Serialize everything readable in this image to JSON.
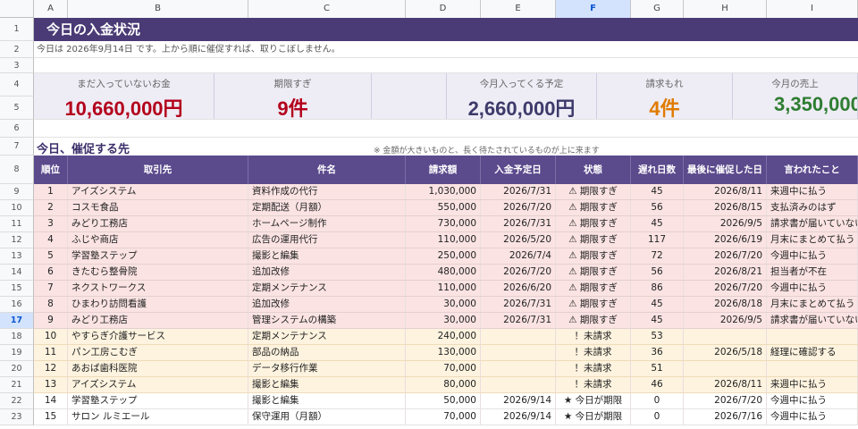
{
  "columns": [
    "A",
    "B",
    "C",
    "D",
    "E",
    "F",
    "G",
    "H",
    "I"
  ],
  "selected_column": "F",
  "rows_header": [
    "1",
    "2",
    "3",
    "4",
    "5",
    "6",
    "7",
    "8",
    "9",
    "10",
    "11",
    "12",
    "13",
    "14",
    "15",
    "16",
    "17",
    "18",
    "19",
    "20",
    "21",
    "22",
    "23"
  ],
  "selected_row": "17",
  "title": "今日の入金状況",
  "subtitle": "今日は 2026年9月14日 です。上から順に催促すれば、取りこぼしません。",
  "kpis": [
    {
      "label": "まだ入っていないお金",
      "value": "10,660,000円",
      "color": "#b3001b"
    },
    {
      "label": "期限すぎ",
      "value": "9件",
      "color": "#b3001b"
    },
    {
      "label": "今月入ってくる予定",
      "value": "2,660,000円",
      "color": "#3d3a6b"
    },
    {
      "label": "請求もれ",
      "value": "4件",
      "color": "#e07b00"
    },
    {
      "label": "今月の売上",
      "value": "3,350,000",
      "color": "#2e7d32"
    }
  ],
  "section_title": "今日、催促する先",
  "section_note": "※ 金額が大きいものと、長く待たされているものが上に来ます",
  "table": {
    "headers": [
      "順位",
      "取引先",
      "件名",
      "請求額",
      "入金予定日",
      "状態",
      "遅れ日数",
      "最後に催促した日",
      "言われたこと"
    ],
    "rows": [
      {
        "type": "over",
        "cells": [
          "1",
          "アイズシステム",
          "資料作成の代行",
          "1,030,000",
          "2026/7/31",
          "⚠ 期限すぎ",
          "45",
          "2026/8/11",
          "来週中に払う"
        ]
      },
      {
        "type": "over",
        "cells": [
          "2",
          "コスモ食品",
          "定期配送（月額）",
          "550,000",
          "2026/7/20",
          "⚠ 期限すぎ",
          "56",
          "2026/8/15",
          "支払済みのはず"
        ]
      },
      {
        "type": "over",
        "cells": [
          "3",
          "みどり工務店",
          "ホームページ制作",
          "730,000",
          "2026/7/31",
          "⚠ 期限すぎ",
          "45",
          "2026/9/5",
          "請求書が届いていない"
        ]
      },
      {
        "type": "over",
        "cells": [
          "4",
          "ふじや商店",
          "広告の運用代行",
          "110,000",
          "2026/5/20",
          "⚠ 期限すぎ",
          "117",
          "2026/6/19",
          "月末にまとめて払う"
        ]
      },
      {
        "type": "over",
        "cells": [
          "5",
          "学習塾ステップ",
          "撮影と編集",
          "250,000",
          "2026/7/4",
          "⚠ 期限すぎ",
          "72",
          "2026/7/20",
          "今週中に払う"
        ]
      },
      {
        "type": "over",
        "cells": [
          "6",
          "きたむら整骨院",
          "追加改修",
          "480,000",
          "2026/7/20",
          "⚠ 期限すぎ",
          "56",
          "2026/8/21",
          "担当者が不在"
        ]
      },
      {
        "type": "over",
        "cells": [
          "7",
          "ネクストワークス",
          "定期メンテナンス",
          "110,000",
          "2026/6/20",
          "⚠ 期限すぎ",
          "86",
          "2026/7/20",
          "今週中に払う"
        ]
      },
      {
        "type": "over",
        "cells": [
          "8",
          "ひまわり訪問看護",
          "追加改修",
          "30,000",
          "2026/7/31",
          "⚠ 期限すぎ",
          "45",
          "2026/8/18",
          "月末にまとめて払う"
        ]
      },
      {
        "type": "over",
        "cells": [
          "9",
          "みどり工務店",
          "管理システムの構築",
          "30,000",
          "2026/7/31",
          "⚠ 期限すぎ",
          "45",
          "2026/9/5",
          "請求書が届いていない"
        ]
      },
      {
        "type": "unbilled",
        "cells": [
          "10",
          "やすらぎ介護サービス",
          "定期メンテナンス",
          "240,000",
          "",
          "！未請求",
          "53",
          "",
          ""
        ]
      },
      {
        "type": "unbilled",
        "cells": [
          "11",
          "パン工房こむぎ",
          "部品の納品",
          "130,000",
          "",
          "！未請求",
          "36",
          "2026/5/18",
          "経理に確認する"
        ]
      },
      {
        "type": "unbilled",
        "cells": [
          "12",
          "あおば歯科医院",
          "データ移行作業",
          "70,000",
          "",
          "！未請求",
          "51",
          "",
          ""
        ]
      },
      {
        "type": "unbilled",
        "cells": [
          "13",
          "アイズシステム",
          "撮影と編集",
          "80,000",
          "",
          "！未請求",
          "46",
          "2026/8/11",
          "来週中に払う"
        ]
      },
      {
        "type": "today",
        "cells": [
          "14",
          "学習塾ステップ",
          "撮影と編集",
          "50,000",
          "2026/9/14",
          "★ 今日が期限",
          "0",
          "2026/7/20",
          "今週中に払う"
        ]
      },
      {
        "type": "today",
        "cells": [
          "15",
          "サロン ルミエール",
          "保守運用（月額）",
          "70,000",
          "2026/9/14",
          "★ 今日が期限",
          "0",
          "2026/7/16",
          "今週中に払う"
        ]
      }
    ]
  }
}
